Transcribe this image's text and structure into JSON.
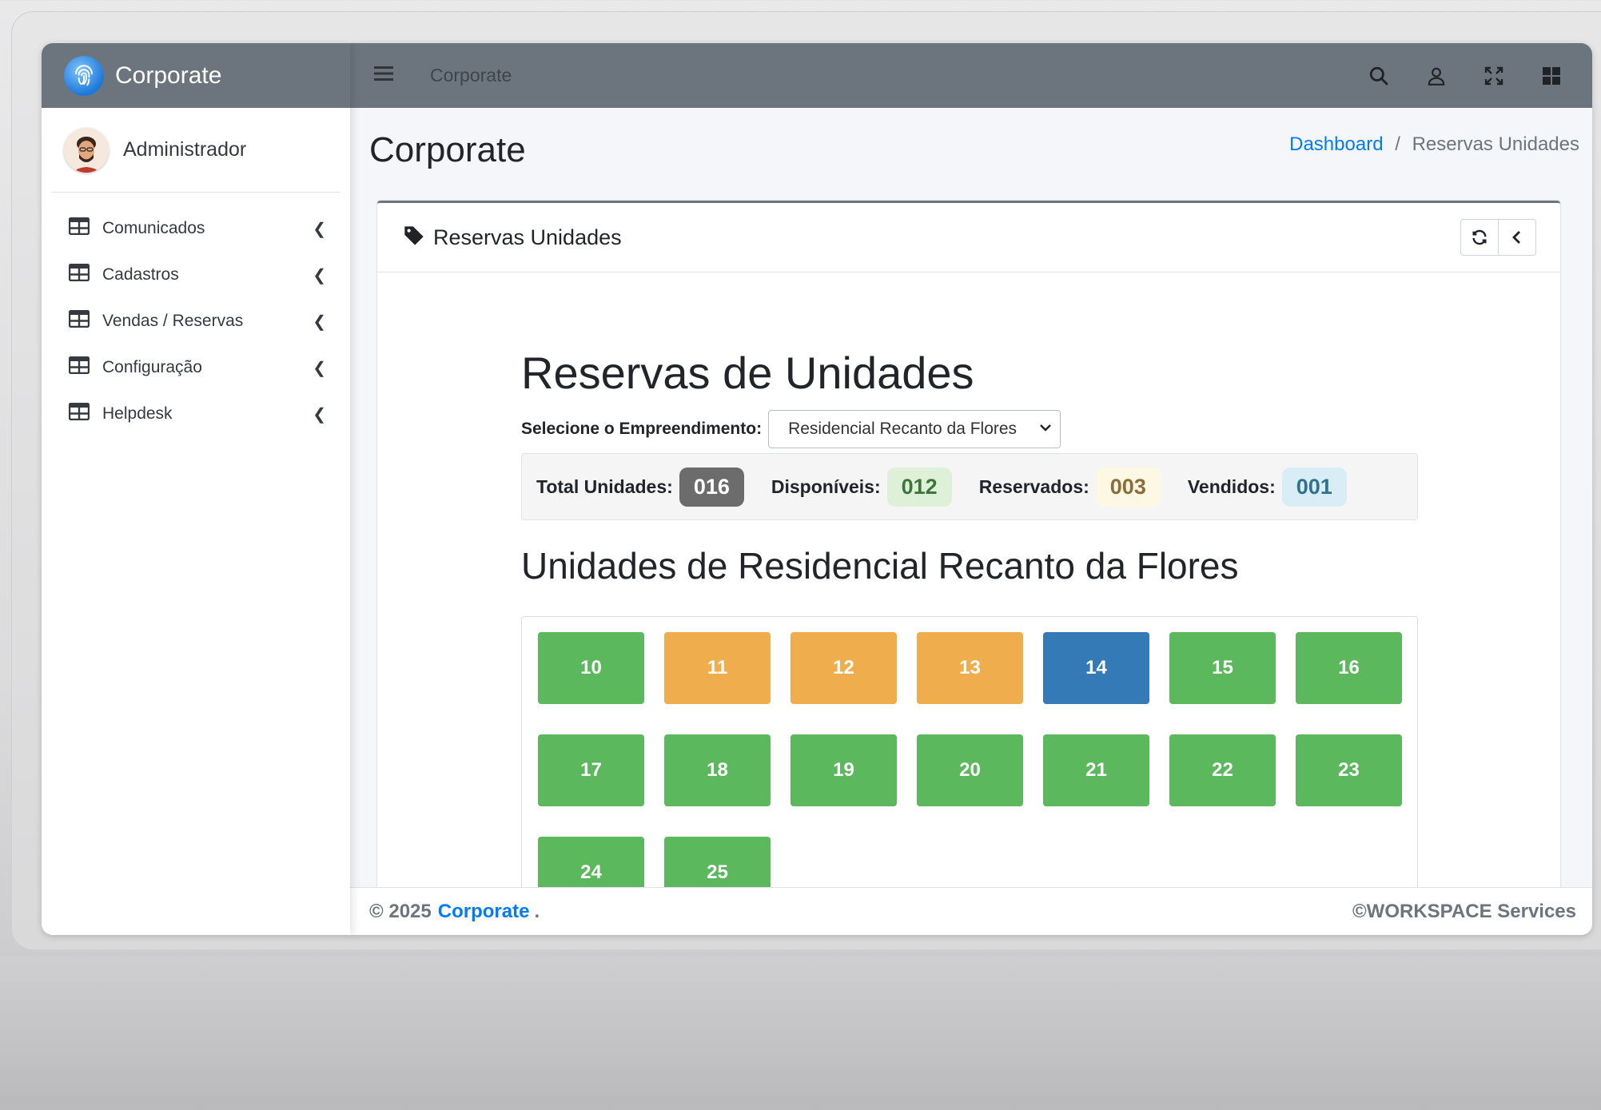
{
  "app": {
    "brand_name": "Corporate",
    "brand_color": "#6c757d"
  },
  "user": {
    "name": "Administrador"
  },
  "sidebar": {
    "items": [
      {
        "label": "Comunicados"
      },
      {
        "label": "Cadastros"
      },
      {
        "label": "Vendas / Reservas"
      },
      {
        "label": "Configuração"
      },
      {
        "label": "Helpdesk"
      }
    ]
  },
  "topbar": {
    "title": "Corporate"
  },
  "page": {
    "title": "Corporate"
  },
  "breadcrumb": {
    "home": "Dashboard",
    "separator": "/",
    "current": "Reservas Unidades"
  },
  "card": {
    "title": "Reservas Unidades"
  },
  "reservas": {
    "heading": "Reservas de Unidades",
    "select_label": "Selecione o Empreendimento:",
    "select_value": "Residencial Recanto da Flores",
    "stats": {
      "total_label": "Total Unidades:",
      "total_value": "016",
      "disp_label": "Disponíveis:",
      "disp_value": "012",
      "res_label": "Reservados:",
      "res_value": "003",
      "vend_label": "Vendidos:",
      "vend_value": "001"
    },
    "units_heading": "Unidades de Residencial Recanto da Flores",
    "status_colors": {
      "available": "#5cb85c",
      "reserved": "#f0ad4e",
      "sold": "#337ab7"
    },
    "units": [
      {
        "number": "10",
        "status": "available"
      },
      {
        "number": "11",
        "status": "reserved"
      },
      {
        "number": "12",
        "status": "reserved"
      },
      {
        "number": "13",
        "status": "reserved"
      },
      {
        "number": "14",
        "status": "sold"
      },
      {
        "number": "15",
        "status": "available"
      },
      {
        "number": "16",
        "status": "available"
      },
      {
        "number": "17",
        "status": "available"
      },
      {
        "number": "18",
        "status": "available"
      },
      {
        "number": "19",
        "status": "available"
      },
      {
        "number": "20",
        "status": "available"
      },
      {
        "number": "21",
        "status": "available"
      },
      {
        "number": "22",
        "status": "available"
      },
      {
        "number": "23",
        "status": "available"
      },
      {
        "number": "24",
        "status": "available"
      },
      {
        "number": "25",
        "status": "available"
      }
    ]
  },
  "footer": {
    "copyright": "© 2025",
    "brand": "Corporate",
    "suffix": ".",
    "right": "©WORKSPACE Services"
  },
  "icons": {
    "brand": "fingerprint-icon",
    "menu": "hamburger-icon",
    "search": "search-icon",
    "user": "user-icon",
    "fullscreen": "expand-icon",
    "apps": "grid-icon",
    "nav": "table-icon",
    "tag": "tag-icon",
    "refresh": "refresh-icon",
    "collapse": "chevron-left-icon"
  }
}
